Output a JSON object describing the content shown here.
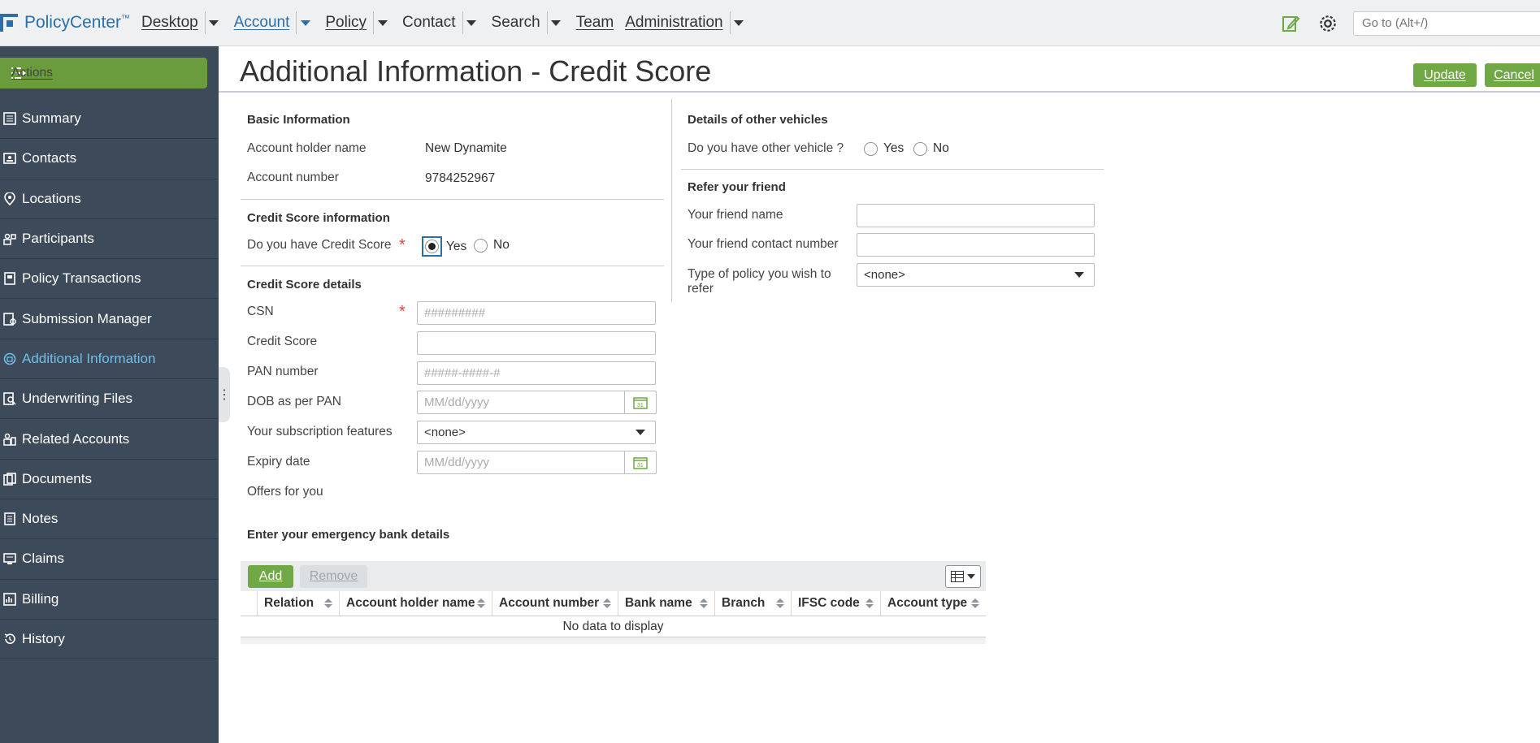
{
  "app": {
    "name": "PolicyCenter",
    "tm": "™"
  },
  "nav": [
    {
      "label": "Desktop",
      "dropdown": true,
      "active": false
    },
    {
      "label": "Account",
      "dropdown": true,
      "active": true
    },
    {
      "label": "Policy",
      "dropdown": true,
      "active": false
    },
    {
      "label": "Contact",
      "dropdown": true,
      "active": false
    },
    {
      "label": "Search",
      "dropdown": true,
      "active": false
    },
    {
      "label": "Team",
      "dropdown": false,
      "active": false
    },
    {
      "label": "Administration",
      "dropdown": true,
      "active": false
    }
  ],
  "goto": {
    "placeholder": "Go to (Alt+/)"
  },
  "sidebar": {
    "actions_label": "Actions",
    "items": [
      {
        "label": "Summary",
        "icon": "summary-icon"
      },
      {
        "label": "Contacts",
        "icon": "contacts-icon"
      },
      {
        "label": "Locations",
        "icon": "location-pin-icon"
      },
      {
        "label": "Participants",
        "icon": "participants-icon"
      },
      {
        "label": "Policy Transactions",
        "icon": "policy-transactions-icon"
      },
      {
        "label": "Submission Manager",
        "icon": "submission-manager-icon"
      },
      {
        "label": "Additional Information",
        "icon": "additional-info-icon",
        "active": true
      },
      {
        "label": "Underwriting Files",
        "icon": "underwriting-files-icon"
      },
      {
        "label": "Related Accounts",
        "icon": "related-accounts-icon"
      },
      {
        "label": "Documents",
        "icon": "documents-icon"
      },
      {
        "label": "Notes",
        "icon": "notes-icon"
      },
      {
        "label": "Claims",
        "icon": "claims-icon"
      },
      {
        "label": "Billing",
        "icon": "billing-icon"
      },
      {
        "label": "History",
        "icon": "history-icon"
      }
    ]
  },
  "page": {
    "title": "Additional Information - Credit Score",
    "update_label": "Update",
    "cancel_label": "Cancel"
  },
  "basic": {
    "heading": "Basic Information",
    "holder_label": "Account holder name",
    "holder_value": "New Dynamite",
    "number_label": "Account number",
    "number_value": "9784252967"
  },
  "credit_info": {
    "heading": "Credit Score information",
    "question": "Do you have Credit Score",
    "yes": "Yes",
    "no": "No",
    "selected": "Yes"
  },
  "credit_details": {
    "heading": "Credit Score details",
    "csn_label": "CSN",
    "csn_placeholder": "#########",
    "score_label": "Credit Score",
    "score_value": "",
    "pan_label": "PAN number",
    "pan_placeholder": "#####-####-#",
    "dob_label": "DOB as per PAN",
    "dob_placeholder": "MM/dd/yyyy",
    "subscription_label": "Your subscription features",
    "subscription_value": "<none>",
    "expiry_label": "Expiry date",
    "expiry_placeholder": "MM/dd/yyyy",
    "offers_label": "Offers for you"
  },
  "vehicles": {
    "heading": "Details of other vehicles",
    "question": "Do you have other vehicle ?",
    "yes": "Yes",
    "no": "No"
  },
  "refer": {
    "heading": "Refer your friend",
    "name_label": "Your friend name",
    "contact_label": "Your friend contact number",
    "policy_label_1": "Type of policy you wish to",
    "policy_label_2": "refer",
    "policy_value": "<none>"
  },
  "bank": {
    "heading": "Enter your emergency bank details",
    "add_label": "Add",
    "remove_label": "Remove",
    "columns": [
      "Relation",
      "Account holder name",
      "Account number",
      "Bank name",
      "Branch",
      "IFSC code",
      "Account type"
    ],
    "empty_text": "No data to display"
  },
  "colors": {
    "accent": "#6fa845",
    "nav_blue": "#2b6fa8",
    "sidebar_bg": "#3d4a59",
    "active_side": "#6fbfe8",
    "required": "#e0453a"
  }
}
